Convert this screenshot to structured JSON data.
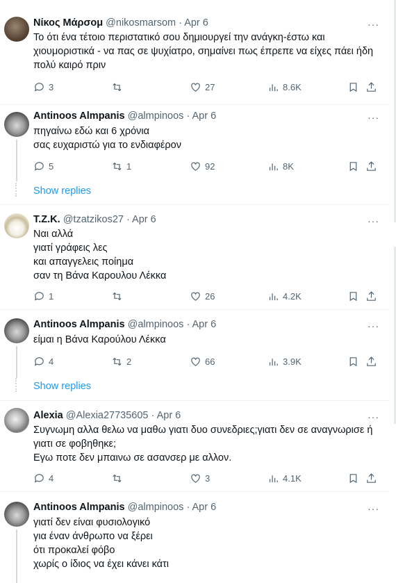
{
  "tweets": [
    {
      "name": "Νίκος Μάρσομ",
      "handle": "@nikosmarsom · Apr 6",
      "text": [
        "Το ότι ένα τέτοιο περιστατικό σου δημιουργεί την ανάγκη-έστω και",
        "χιουμοριστικά - να πας σε ψυχίατρο, σημαίνει πως έπρεπε να είχες πάει ήδη",
        "πολύ καιρό πριν"
      ],
      "replies": "3",
      "reposts": "",
      "likes": "27",
      "views": "8.6K"
    },
    {
      "name": "Antinoos Almpanis",
      "handle": "@almpinoos · Apr 6",
      "text": [
        "πηγαίνω εδώ και 6 χρόνια",
        "σας ευχαριστώ για το ενδιαφέρον"
      ],
      "replies": "5",
      "reposts": "1",
      "likes": "92",
      "views": "8K"
    },
    {
      "name": "T.Z.K.",
      "handle": "@tzatzikos27 · Apr 6",
      "text": [
        "Ναι αλλά",
        "γιατί γράφεις λες",
        "και απαγγελεις ποίημα",
        "σαν τη Βάνα Καρουλου Λέκκα"
      ],
      "replies": "1",
      "reposts": "",
      "likes": "26",
      "views": "4.2K"
    },
    {
      "name": "Antinoos Almpanis",
      "handle": "@almpinoos · Apr 6",
      "text": [
        "είμαι η Βάνα Καρούλου Λέκκα"
      ],
      "replies": "4",
      "reposts": "2",
      "likes": "66",
      "views": "3.9K"
    },
    {
      "name": "Alexia",
      "handle": "@Alexia27735605 · Apr 6",
      "text": [
        "Συγνωμη αλλα θελω να μαθω γιατι δυο συνεδριες;γιατι δεν σε αναγνωρισε ή",
        "γιατι σε φοβηθηκε;",
        "Εγω ποτε δεν μπαινω σε ασανσερ με αλλον."
      ],
      "replies": "4",
      "reposts": "",
      "likes": "3",
      "views": "4.1K"
    },
    {
      "name": "Antinoos Almpanis",
      "handle": "@almpinoos · Apr 6",
      "text": [
        "γιατί δεν είναι φυσιολογικό",
        "για έναν άνθρωπο να ξέρει",
        "ότι προκαλεί φόβο",
        "χωρίς ο ίδιος να έχει κάνει κάτι"
      ],
      "replies": "",
      "reposts": "",
      "likes": "",
      "views": ""
    }
  ],
  "show_replies": "Show replies",
  "more_label": "···",
  "icons": [
    "reply-icon",
    "repost-icon",
    "like-icon",
    "views-icon",
    "bookmark-icon",
    "share-icon"
  ]
}
